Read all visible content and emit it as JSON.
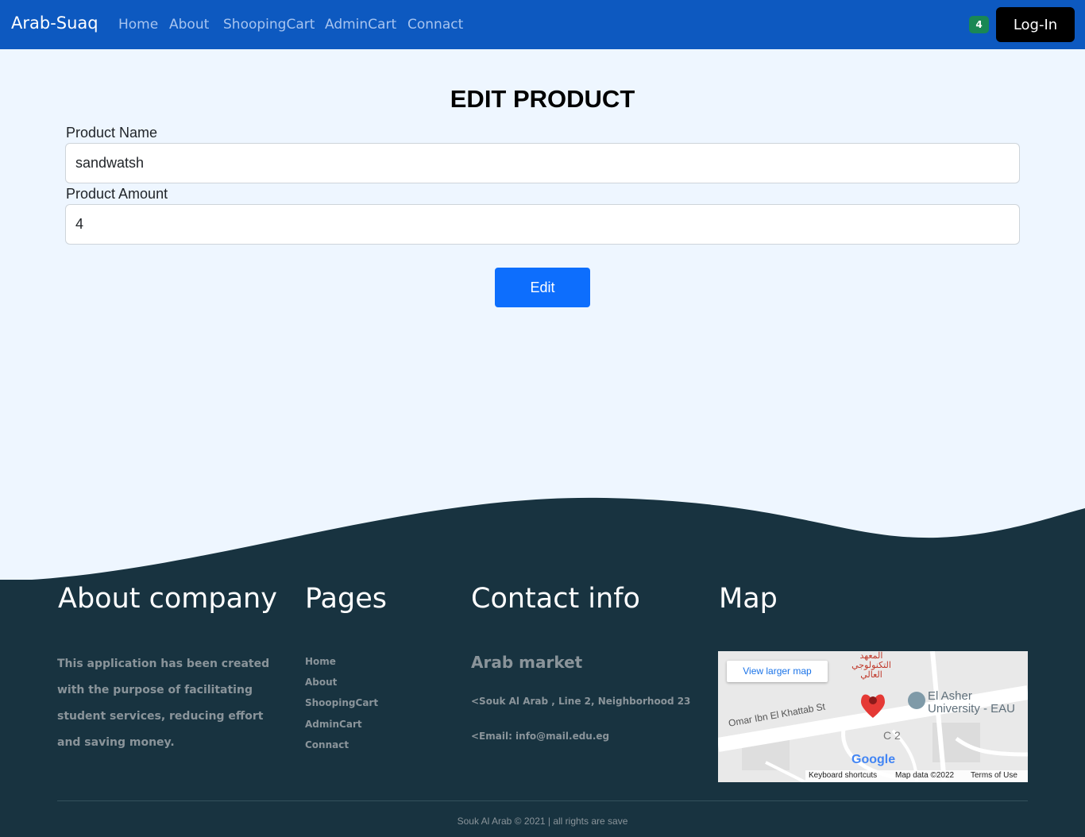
{
  "navbar": {
    "brand": "Arab-Suaq",
    "links": [
      "Home",
      "About",
      "ShoopingCart",
      "AdminCart",
      "Connact"
    ],
    "cart_count": "4",
    "login_label": "Log-In"
  },
  "form": {
    "title": "EDIT PRODUCT",
    "name_label": "Product Name",
    "name_value": "sandwatsh",
    "amount_label": "Product Amount",
    "amount_value": "4",
    "submit_label": "Edit"
  },
  "footer": {
    "about": {
      "heading": "About company",
      "text": "This application has been created with the purpose of facilitating student services, reducing effort and saving money."
    },
    "pages": {
      "heading": "Pages",
      "links": [
        "Home",
        "About",
        "ShoopingCart",
        "AdminCart",
        "Connact"
      ]
    },
    "contact": {
      "heading": "Contact info",
      "name": "Arab market",
      "address": "<Souk Al Arab , Line 2, Neighborhood 23",
      "email": "<Email: info@mail.edu.eg"
    },
    "map": {
      "heading": "Map",
      "view_larger": "View larger map",
      "street": "Omar Ibn El Khattab St",
      "university": "El Asher",
      "university_line2": "University - EAU",
      "institute_ar": "المعهد التكنولوجي العالي",
      "block": "C 2",
      "logo": "Google",
      "shortcuts": "Keyboard shortcuts",
      "map_data": "Map data ©2022",
      "terms": "Terms of Use"
    },
    "copyright": "Souk Al Arab © 2021 | all rights are save"
  },
  "colors": {
    "navbar": "#0d59c0",
    "page_bg": "#eef6ff",
    "footer_bg": "#183340",
    "primary_button": "#0d6efd",
    "badge": "#198754"
  }
}
